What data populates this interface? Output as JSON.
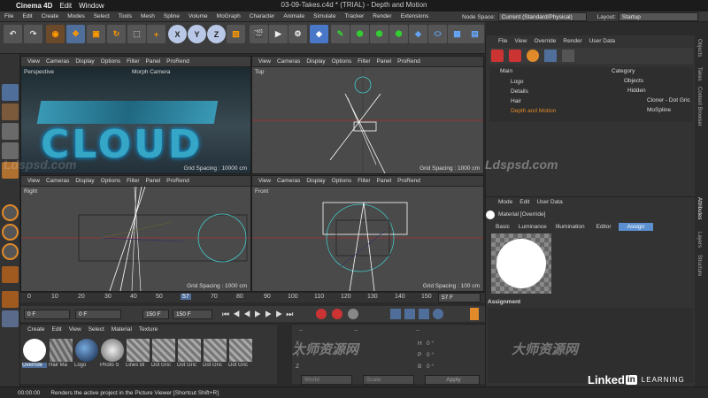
{
  "mac": {
    "apple": "",
    "app": "Cinema 4D",
    "edit": "Edit",
    "window": "Window",
    "title": "03-09-Takes.c4d * (TRIAL) - Depth and Motion"
  },
  "menu": [
    "File",
    "Edit",
    "Create",
    "Modes",
    "Select",
    "Tools",
    "Mesh",
    "Spline",
    "Volume",
    "MoGraph",
    "Character",
    "Animate",
    "Simulate",
    "Tracker",
    "Render",
    "Extensions"
  ],
  "node_space_label": "Node Space:",
  "node_space_value": "Current (Standard/Physical)",
  "layout_label": "Layout:",
  "layout_value": "Startup",
  "toolbar": {
    "x": "X",
    "y": "Y",
    "z": "Z"
  },
  "viewport_menu": [
    "View",
    "Cameras",
    "Display",
    "Options",
    "Filter",
    "Panel",
    "ProRend"
  ],
  "vp1": {
    "label": "Perspective",
    "camera": "Morph Camera",
    "grid": "Grid Spacing : 10000 cm",
    "logo_text": "CLOUD"
  },
  "vp2": {
    "label": "Top",
    "grid": "Grid Spacing : 1000 cm"
  },
  "vp3": {
    "label": "Right",
    "grid": "Grid Spacing : 1000 cm"
  },
  "vp4": {
    "label": "Front",
    "grid": "Grid Spacing : 100 cm"
  },
  "timeline": {
    "ticks": [
      "0",
      "10",
      "20",
      "30",
      "40",
      "50",
      "57",
      "70",
      "80",
      "90",
      "100",
      "110",
      "120",
      "130",
      "140",
      "150"
    ],
    "current": "57 F"
  },
  "controls": {
    "f1": "0 F",
    "f2": "0 F",
    "f3": "150 F",
    "f4": "150 F"
  },
  "material_menu": [
    "Create",
    "Edit",
    "View",
    "Select",
    "Material",
    "Texture"
  ],
  "materials": [
    "Override",
    "Hair Ma",
    "Logo",
    "Photo S",
    "Lines Bl",
    "Dot Gric",
    "Dot Gric",
    "Dot Gric",
    "Dot Gric"
  ],
  "coords": {
    "bar": "--",
    "x": "X",
    "y": "Y",
    "z": "Z",
    "h": "H",
    "p": "P",
    "b": "B",
    "hv": "0 °",
    "pv": "0 °",
    "bv": "0 °",
    "world": "World",
    "scale": "Scale",
    "apply": "Apply"
  },
  "object_menu": [
    "File",
    "View",
    "Override",
    "Render",
    "User Data"
  ],
  "takes": [
    "Main",
    "Logo",
    "Details",
    "Hair",
    "Depth and Motion"
  ],
  "category": {
    "label": "Category",
    "objects": "Objects",
    "hidden": "Hidden",
    "cloner": "Cloner - Dot Gric",
    "mospline": "MoSpline"
  },
  "attributes": {
    "menu": [
      "Mode",
      "Edit",
      "User Data"
    ],
    "title": "Material [Override]",
    "tabs": [
      "Basic",
      "Luminance",
      "Illumination",
      "Editor",
      "Assign"
    ],
    "assignment": "Assignment"
  },
  "right_tabs": [
    "Objects",
    "Takes",
    "Content Browser",
    "Attributes",
    "Layers",
    "Structure"
  ],
  "status": {
    "time": "00:00:00",
    "text": "Renders the active project in the Picture Viewer [Shortcut Shift+R]"
  },
  "watermarks": {
    "lds1": "Ldspsd.com",
    "lds2": "Ldspsd.com",
    "cn": "大师资源网",
    "linkedin": "Linked",
    "in": "in",
    "learning": "LEARNING"
  },
  "colors": {
    "accent": "#5b8fd0",
    "orange": "#e08a2a",
    "bg": "#2b2b2b"
  }
}
